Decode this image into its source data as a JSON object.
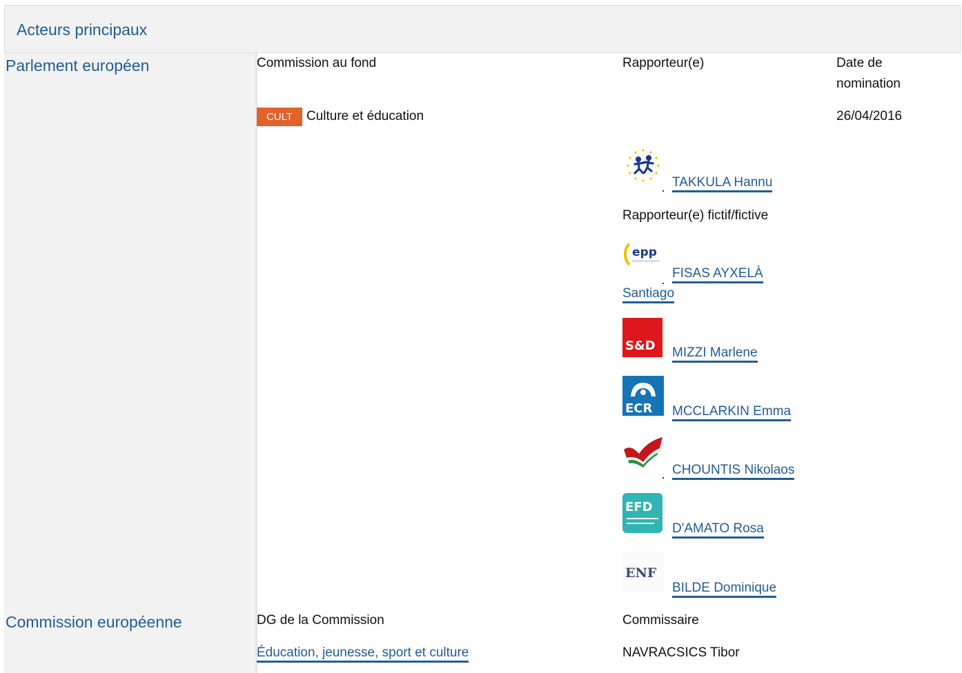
{
  "header": {
    "title": "Acteurs principaux"
  },
  "parliament": {
    "label": "Parlement européen",
    "col_committee": "Commission au fond",
    "col_rapporteur": "Rapporteur(e)",
    "col_date": "Date de nomination",
    "committee_code": "CULT",
    "committee_name": "Culture et éducation",
    "date": "26/04/2016",
    "rapporteur": {
      "name": "TAKKULA Hannu",
      "group_logo": "alde-logo"
    },
    "shadow_label": "Rapporteur(e) fictif/fictive",
    "shadows": [
      {
        "name_line1": "FISAS AYXELÀ",
        "name_line2": "Santiago",
        "group_logo": "epp-logo"
      },
      {
        "name": "MIZZI Marlene",
        "group_logo": "sd-logo"
      },
      {
        "name": "MCCLARKIN Emma",
        "group_logo": "ecr-logo"
      },
      {
        "name": "CHOUNTIS Nikolaos",
        "group_logo": "gue-ngl-logo"
      },
      {
        "name": "D'AMATO Rosa",
        "group_logo": "efdd-logo"
      },
      {
        "name": "BILDE Dominique",
        "group_logo": "enf-logo"
      }
    ]
  },
  "commission": {
    "label": "Commission européenne",
    "col_dg": "DG de la Commission",
    "col_commissioner": "Commissaire",
    "dg": "Éducation, jeunesse, sport et culture",
    "commissioner": "NAVRACSICS Tibor"
  },
  "colors": {
    "link": "#1f5d96",
    "badge": "#e2622b",
    "header_bg": "#f2f2f2"
  }
}
